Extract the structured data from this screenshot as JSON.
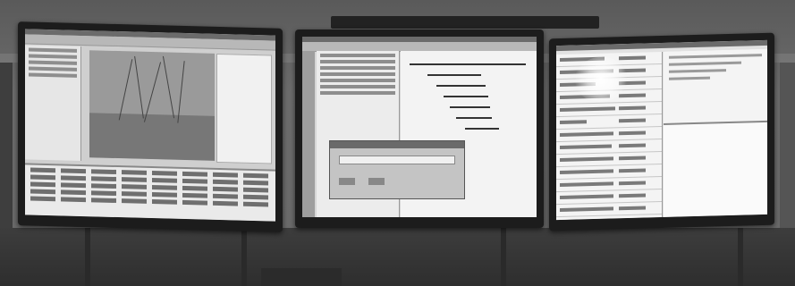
{
  "scene": {
    "description_type": "photo",
    "monitors": [
      {
        "id": "left",
        "content": "gis-application"
      },
      {
        "id": "center",
        "content": "gantt-scheduler"
      },
      {
        "id": "right",
        "content": "message-list"
      }
    ]
  },
  "colors": {
    "wall": "#6a6a6a",
    "bezel": "#1c1c1c",
    "screen_light": "#e2e2e2",
    "floor": "#2e2e2e"
  }
}
